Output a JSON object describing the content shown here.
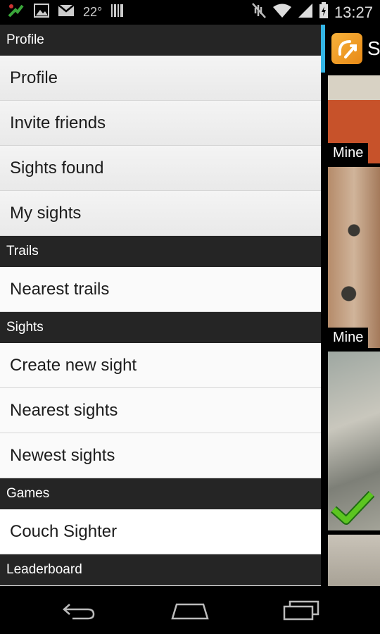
{
  "status_bar": {
    "temperature": "22°",
    "time": "13:27",
    "icons": [
      "fake-gps-icon",
      "image-icon",
      "gmail-icon",
      "barcode-icon",
      "mute-icon",
      "wifi-icon",
      "signal-icon",
      "battery-icon"
    ]
  },
  "drawer": {
    "sections": [
      {
        "header": "Profile",
        "items": [
          "Profile",
          "Invite friends",
          "Sights found",
          "My sights"
        ]
      },
      {
        "header": "Trails",
        "items": [
          "Nearest trails"
        ]
      },
      {
        "header": "Sights",
        "items": [
          "Create new sight",
          "Nearest sights",
          "Newest sights"
        ]
      },
      {
        "header": "Games",
        "items": [
          "Couch Sighter"
        ]
      },
      {
        "header": "Leaderboard",
        "items": []
      }
    ]
  },
  "content": {
    "app_title": "Si",
    "thumbnails": [
      {
        "badge": "Mine"
      },
      {
        "badge": "Mine"
      },
      {
        "badge": "",
        "found": true
      },
      {
        "badge": ""
      }
    ]
  },
  "colors": {
    "accent": "#33b5e5",
    "section_header_bg": "#252525",
    "item_bg": "#f2f2f2",
    "check": "#5cc521"
  }
}
